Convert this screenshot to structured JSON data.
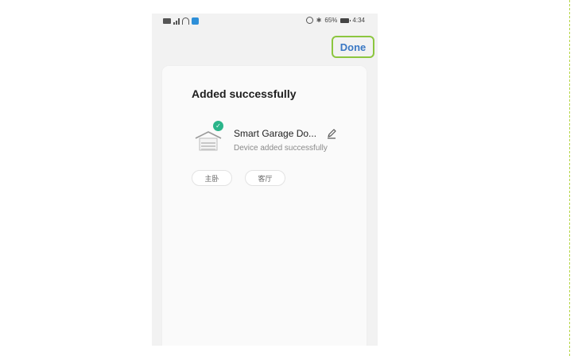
{
  "status_bar": {
    "battery_text": "65%",
    "time": "4:34"
  },
  "header": {
    "done_label": "Done"
  },
  "card": {
    "title": "Added successfully",
    "device": {
      "name": "Smart Garage Do...",
      "status": "Device added successfully",
      "icon": "garage-door-icon",
      "badge_icon": "check-icon"
    },
    "rooms": [
      {
        "label": "主卧"
      },
      {
        "label": "客厅"
      }
    ]
  },
  "colors": {
    "accent": "#3a78c4",
    "highlight_border": "#8cc63f",
    "success": "#2bb58a"
  }
}
